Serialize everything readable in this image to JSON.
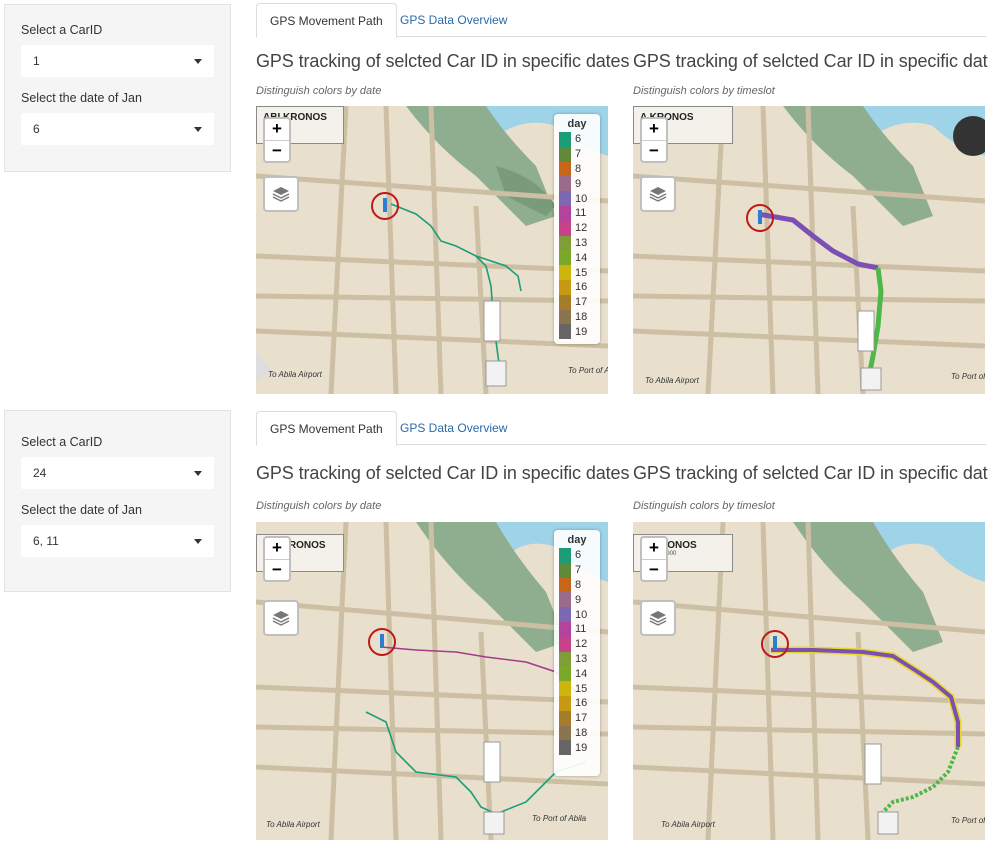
{
  "panels": [
    {
      "sidebar": {
        "carid_label": "Select a CarID",
        "carid_value": "1",
        "date_label": "Select the date of Jan",
        "date_value": "6"
      },
      "tabs": [
        "GPS Movement Path",
        "GPS Data Overview"
      ],
      "left_plot": {
        "title": "GPS tracking of selcted Car ID in specific dates",
        "subtitle": "Distinguish colors by date",
        "map_title": "ABI KRONOS",
        "map_title_sub": "213,900",
        "map_labels": [
          "To Abila Airport",
          "To Port of Abil"
        ]
      },
      "right_plot": {
        "title": "GPS tracking of selcted Car ID in specific dates",
        "subtitle": "Distinguish colors by timeslot",
        "map_title": "A KRONOS",
        "map_title_sub": "213,900",
        "map_labels": [
          "To Abila Airport",
          "To Port of Abil"
        ]
      }
    },
    {
      "sidebar": {
        "carid_label": "Select a CarID",
        "carid_value": "24",
        "date_label": "Select the date of Jan",
        "date_value": "6, 11"
      },
      "tabs": [
        "GPS Movement Path",
        "GPS Data Overview"
      ],
      "left_plot": {
        "title": "GPS tracking of selcted Car ID in specific dates",
        "subtitle": "Distinguish colors by date",
        "map_title": "BIL KRONOS",
        "map_title_sub": "213,900",
        "map_labels": [
          "To Abila Airport",
          "To Port of Abila"
        ]
      },
      "right_plot": {
        "title": "GPS tracking of selcted Car ID in specific dates",
        "subtitle": "Distinguish colors by timeslot",
        "map_title": "A, KRONOS",
        "map_title_sub": "ation 213,900",
        "map_labels": [
          "To Abila Airport",
          "To Port of Abil"
        ]
      }
    }
  ],
  "legend": {
    "title": "day",
    "items": [
      {
        "label": "6",
        "color": "#1b9e77"
      },
      {
        "label": "7",
        "color": "#5f8a3c"
      },
      {
        "label": "8",
        "color": "#c7661a"
      },
      {
        "label": "9",
        "color": "#9a6b8b"
      },
      {
        "label": "10",
        "color": "#7d68b3"
      },
      {
        "label": "11",
        "color": "#b4449b"
      },
      {
        "label": "12",
        "color": "#c8428a"
      },
      {
        "label": "13",
        "color": "#7f9e3a"
      },
      {
        "label": "14",
        "color": "#7aa82a"
      },
      {
        "label": "15",
        "color": "#cdb50f"
      },
      {
        "label": "16",
        "color": "#c89a14"
      },
      {
        "label": "17",
        "color": "#a57c2b"
      },
      {
        "label": "18",
        "color": "#8a7550"
      },
      {
        "label": "19",
        "color": "#666666"
      }
    ]
  },
  "zoom": {
    "plus": "+",
    "minus": "−"
  },
  "icons": {
    "layers": "layers-icon",
    "caret": "caret-down-icon"
  }
}
